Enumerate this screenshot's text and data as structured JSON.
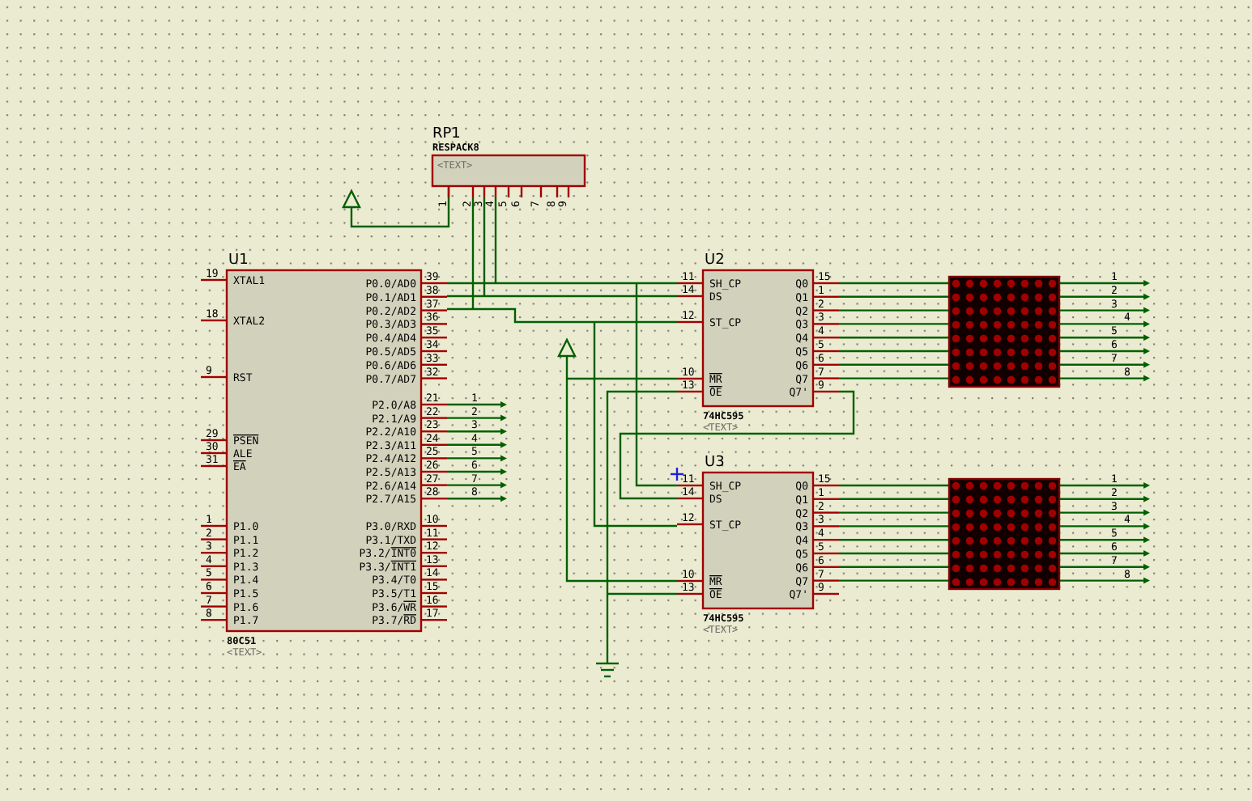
{
  "rp1": {
    "ref": "RP1",
    "part": "RESPACK8",
    "text": "<TEXT>",
    "pins": [
      "1",
      "2",
      "3",
      "4",
      "5",
      "6",
      "7",
      "8",
      "9"
    ]
  },
  "u1": {
    "ref": "U1",
    "part": "80C51",
    "text": "<TEXT>",
    "left_pins": [
      {
        "num": "19",
        "name": "XTAL1"
      },
      {
        "num": "18",
        "name": "XTAL2"
      },
      {
        "num": "9",
        "name": "RST"
      },
      {
        "num": "29",
        "bar": "PSEN"
      },
      {
        "num": "30",
        "name": "ALE"
      },
      {
        "num": "31",
        "bar": "EA"
      },
      {
        "num": "1",
        "name": "P1.0"
      },
      {
        "num": "2",
        "name": "P1.1"
      },
      {
        "num": "3",
        "name": "P1.2"
      },
      {
        "num": "4",
        "name": "P1.3"
      },
      {
        "num": "5",
        "name": "P1.4"
      },
      {
        "num": "6",
        "name": "P1.5"
      },
      {
        "num": "7",
        "name": "P1.6"
      },
      {
        "num": "8",
        "name": "P1.7"
      }
    ],
    "right_pins": [
      {
        "num": "39",
        "name": "P0.0/AD0"
      },
      {
        "num": "38",
        "name": "P0.1/AD1"
      },
      {
        "num": "37",
        "name": "P0.2/AD2"
      },
      {
        "num": "36",
        "name": "P0.3/AD3"
      },
      {
        "num": "35",
        "name": "P0.4/AD4"
      },
      {
        "num": "34",
        "name": "P0.5/AD5"
      },
      {
        "num": "33",
        "name": "P0.6/AD6"
      },
      {
        "num": "32",
        "name": "P0.7/AD7"
      },
      {
        "num": "21",
        "name": "P2.0/A8",
        "net": "1"
      },
      {
        "num": "22",
        "name": "P2.1/A9",
        "net": "2"
      },
      {
        "num": "23",
        "name": "P2.2/A10",
        "net": "3"
      },
      {
        "num": "24",
        "name": "P2.3/A11",
        "net": "4"
      },
      {
        "num": "25",
        "name": "P2.4/A12",
        "net": "5"
      },
      {
        "num": "26",
        "name": "P2.5/A13",
        "net": "6"
      },
      {
        "num": "27",
        "name": "P2.6/A14",
        "net": "7"
      },
      {
        "num": "28",
        "name": "P2.7/A15",
        "net": "8"
      },
      {
        "num": "10",
        "name": "P3.0/RXD"
      },
      {
        "num": "11",
        "name": "P3.1/TXD"
      },
      {
        "num": "12",
        "name": "P3.2/",
        "bar": "INT0"
      },
      {
        "num": "13",
        "name": "P3.3/",
        "bar": "INT1"
      },
      {
        "num": "14",
        "name": "P3.4/T0"
      },
      {
        "num": "15",
        "name": "P3.5/T1"
      },
      {
        "num": "16",
        "name": "P3.6/",
        "bar": "WR"
      },
      {
        "num": "17",
        "name": "P3.7/",
        "bar": "RD"
      }
    ]
  },
  "u2": {
    "ref": "U2",
    "part": "74HC595",
    "text": "<TEXT>",
    "left_pins": [
      {
        "num": "11",
        "name": "SH_CP"
      },
      {
        "num": "14",
        "name": "DS"
      },
      {
        "num": "12",
        "name": "ST_CP"
      },
      {
        "num": "10",
        "bar": "MR"
      },
      {
        "num": "13",
        "bar": "OE"
      }
    ],
    "right_pins": [
      {
        "num": "15",
        "name": "Q0"
      },
      {
        "num": "1",
        "name": "Q1"
      },
      {
        "num": "2",
        "name": "Q2"
      },
      {
        "num": "3",
        "name": "Q3"
      },
      {
        "num": "4",
        "name": "Q4"
      },
      {
        "num": "5",
        "name": "Q5"
      },
      {
        "num": "6",
        "name": "Q6"
      },
      {
        "num": "7",
        "name": "Q7"
      },
      {
        "num": "9",
        "name": "Q7'"
      }
    ]
  },
  "u3": {
    "ref": "U3",
    "part": "74HC595",
    "text": "<TEXT>",
    "left_pins": [
      {
        "num": "11",
        "name": "SH_CP"
      },
      {
        "num": "14",
        "name": "DS"
      },
      {
        "num": "12",
        "name": "ST_CP"
      },
      {
        "num": "10",
        "bar": "MR"
      },
      {
        "num": "13",
        "bar": "OE"
      }
    ],
    "right_pins": [
      {
        "num": "15",
        "name": "Q0"
      },
      {
        "num": "1",
        "name": "Q1"
      },
      {
        "num": "2",
        "name": "Q2"
      },
      {
        "num": "3",
        "name": "Q3"
      },
      {
        "num": "4",
        "name": "Q4"
      },
      {
        "num": "5",
        "name": "Q5"
      },
      {
        "num": "6",
        "name": "Q6"
      },
      {
        "num": "7",
        "name": "Q7"
      },
      {
        "num": "9",
        "name": "Q7'"
      }
    ]
  },
  "matrices": [
    {
      "row_labels": [
        "1",
        "2",
        "3",
        "4",
        "5",
        "6",
        "7",
        "8"
      ]
    },
    {
      "row_labels": [
        "1",
        "2",
        "3",
        "4",
        "5",
        "6",
        "7",
        "8"
      ]
    }
  ]
}
